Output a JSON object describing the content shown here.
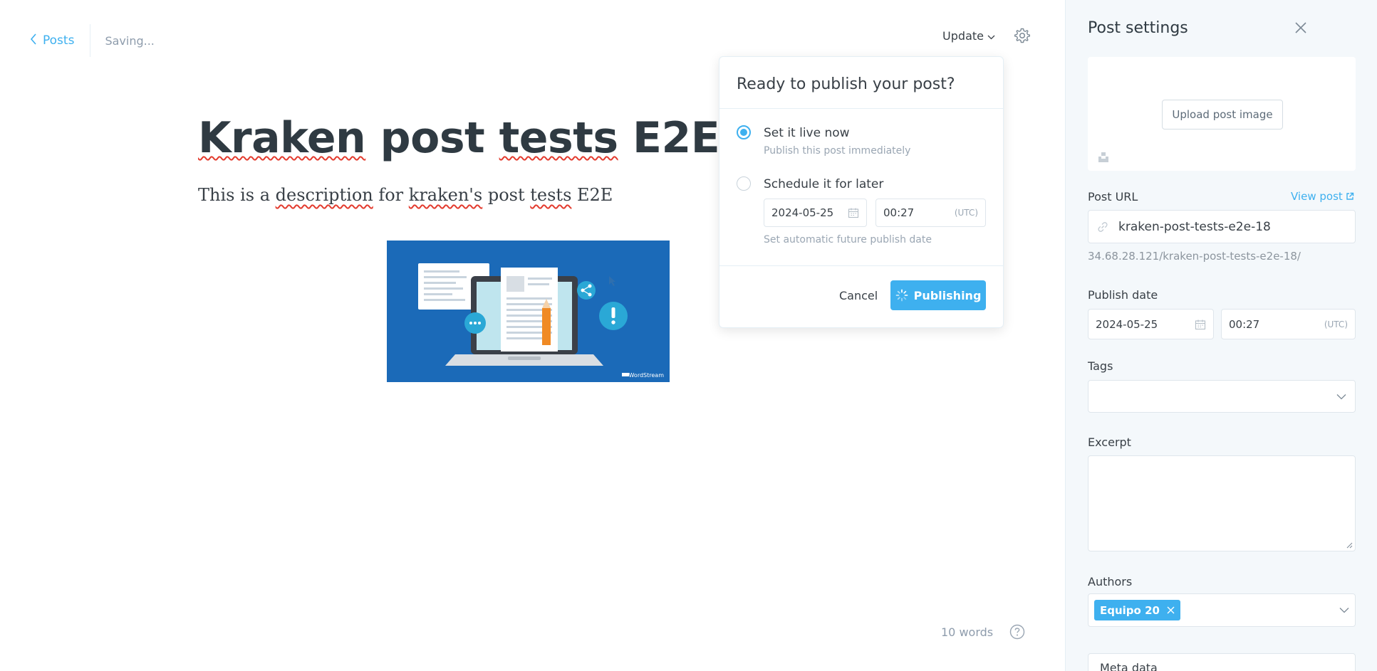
{
  "editor": {
    "back_label": "Posts",
    "status": "Saving...",
    "update_label": "Update",
    "title": {
      "part1": "Kraken",
      "part2": " post ",
      "part3": "tests",
      "part4": " E2E"
    },
    "description": {
      "part1": "This is a ",
      "part2": "description",
      "part3": " for ",
      "part4": "kraken's",
      "part5": " post ",
      "part6": "tests",
      "part7": " E2E"
    },
    "image_watermark": "WordStream",
    "word_count": "10 words"
  },
  "publish_popover": {
    "heading": "Ready to publish your post?",
    "option_live": {
      "label": "Set it live now",
      "sublabel": "Publish this post immediately",
      "selected": true
    },
    "option_later": {
      "label": "Schedule it for later",
      "date": "2024-05-25",
      "time": "00:27",
      "timezone": "(UTC)",
      "note": "Set automatic future publish date",
      "selected": false
    },
    "cancel_label": "Cancel",
    "publish_label": "Publishing"
  },
  "settings": {
    "heading": "Post settings",
    "upload_label": "Upload post image",
    "url_label": "Post URL",
    "view_post_label": "View post",
    "slug": "kraken-post-tests-e2e-18",
    "url_preview": "34.68.28.121/kraken-post-tests-e2e-18/",
    "publish_date_label": "Publish date",
    "publish_date": "2024-05-25",
    "publish_time": "00:27",
    "timezone": "(UTC)",
    "tags_label": "Tags",
    "excerpt_label": "Excerpt",
    "authors_label": "Authors",
    "author_name": "Equipo 20",
    "meta_label": "Meta data"
  },
  "colors": {
    "accent": "#3eb0ef",
    "sidebar_bg": "#f4f8fb",
    "spellcheck": "#e33b2e",
    "image_bg": "#1b6ab8"
  }
}
